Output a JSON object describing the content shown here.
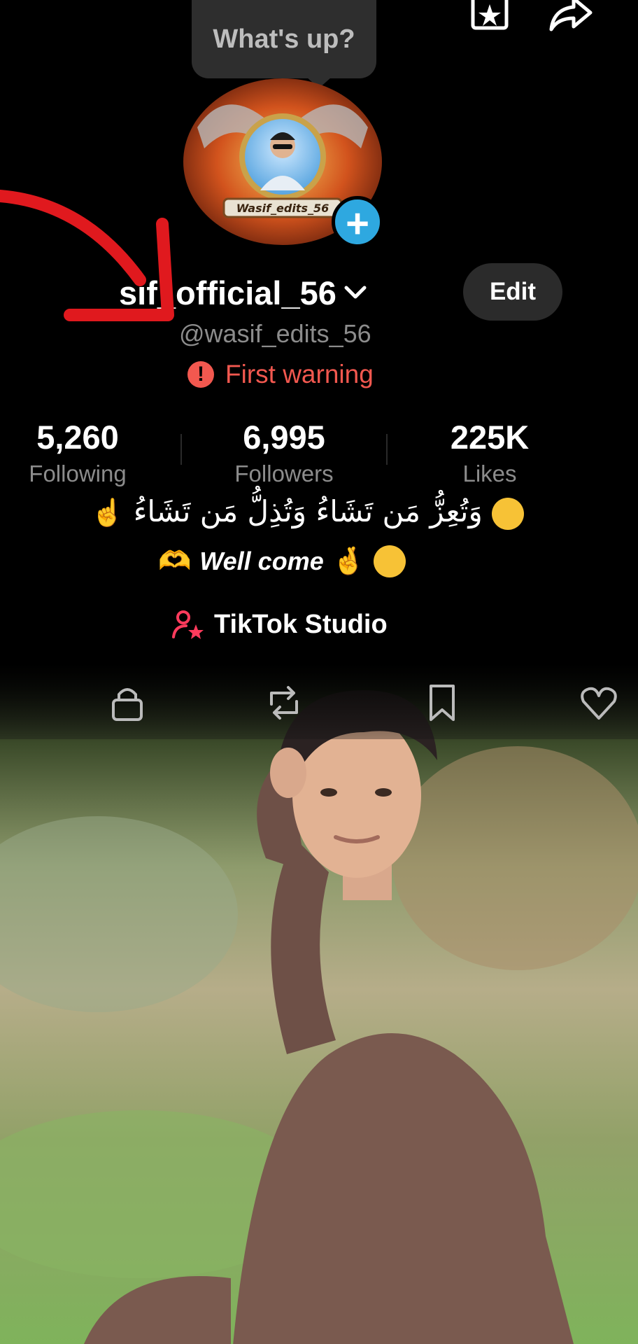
{
  "tooltip": {
    "text": "What's up?"
  },
  "top_icons": [
    "star-bookmark-icon",
    "share-arrow-icon"
  ],
  "avatar": {
    "badge_text": "Wasif_edits_56",
    "add_icon": "plus-icon"
  },
  "profile": {
    "username": "sif_official_56",
    "edit_label": "Edit",
    "handle": "@wasif_edits_56",
    "warning_text": "First warning",
    "warning_icon": "!"
  },
  "stats": [
    {
      "value": "5,260",
      "label": "Following"
    },
    {
      "value": "6,995",
      "label": "Followers"
    },
    {
      "value": "225K",
      "label": "Likes"
    }
  ],
  "bio": {
    "line1": "وَتُعِزُّ مَن تَشَاءُ وَتُذِلُّ مَن تَشَاءُ",
    "line2": "Well come"
  },
  "studio": {
    "label": "TikTok Studio"
  },
  "tabs": [
    "lock-icon",
    "repost-icon",
    "bookmark-icon",
    "heart-icon"
  ],
  "colors": {
    "warning": "#f2584f",
    "plus_badge": "#2ea8e0",
    "studio_icon": "#ff3b5c",
    "annotation_arrow": "#e0191e"
  }
}
